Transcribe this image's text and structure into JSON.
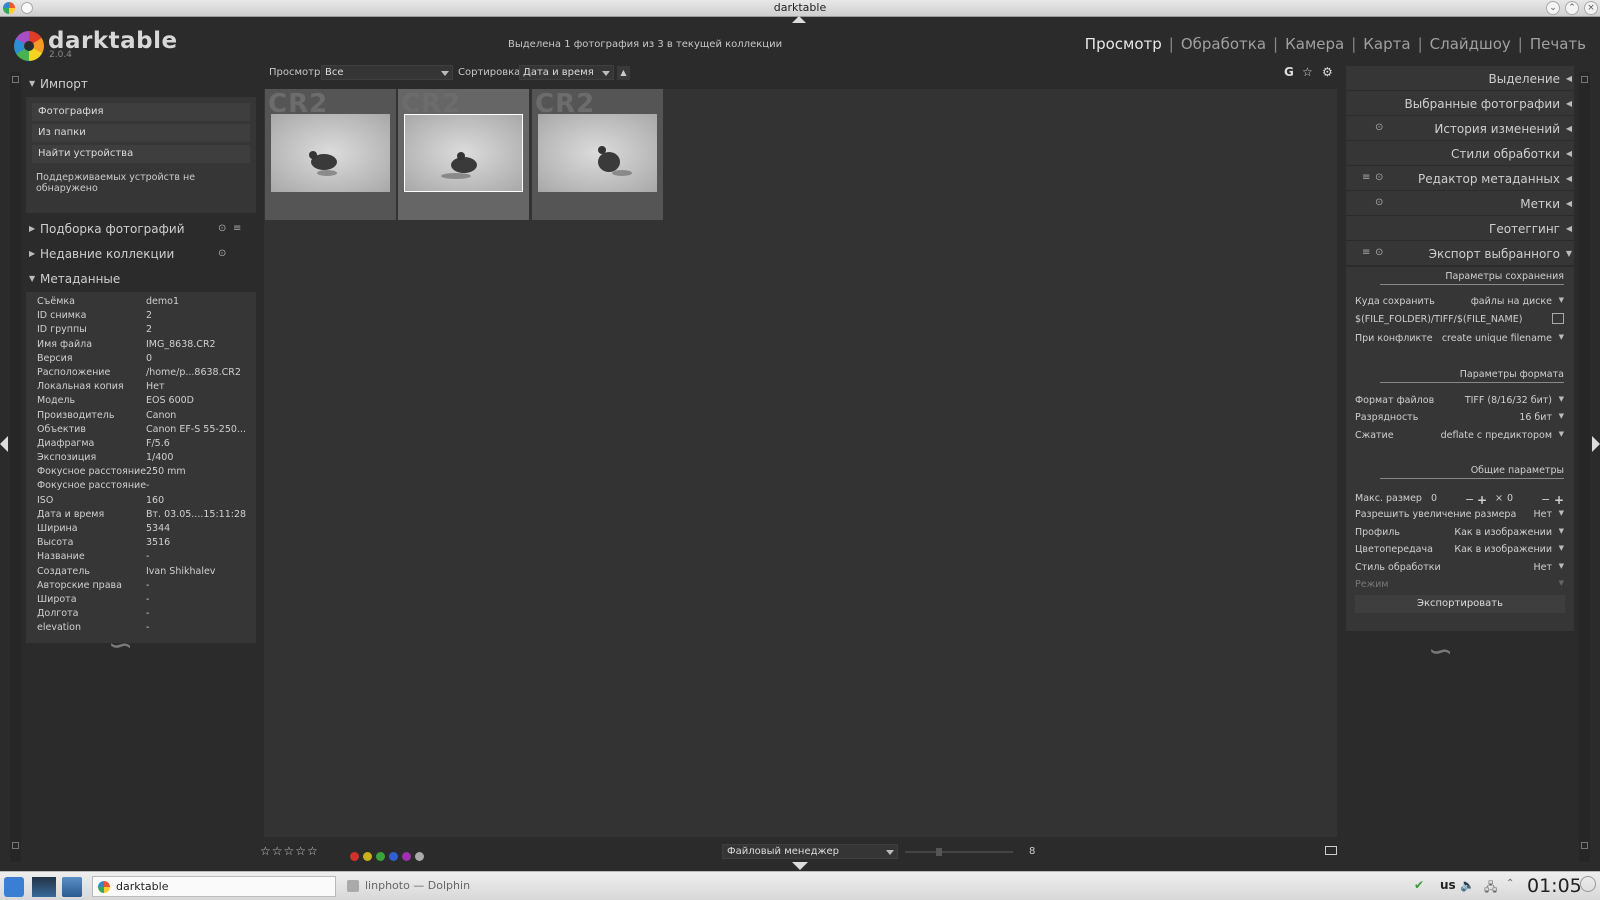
{
  "window": {
    "title": "darktable"
  },
  "app": {
    "name": "darktable",
    "version": "2.0.4"
  },
  "status": "Выделена 1 фотография из 3 в текущей коллекции",
  "views": [
    {
      "label": "Просмотр",
      "active": true
    },
    {
      "label": "Обработка",
      "active": false
    },
    {
      "label": "Камера",
      "active": false
    },
    {
      "label": "Карта",
      "active": false
    },
    {
      "label": "Слайдшоу",
      "active": false
    },
    {
      "label": "Печать",
      "active": false
    }
  ],
  "view_separator": "|",
  "toolbar": {
    "view_label": "Просмотр",
    "view_value": "Все",
    "sort_label": "Сортировка",
    "sort_value": "Дата и время",
    "sort_dir": "▲",
    "grouping_icon": "G",
    "star_icon": "☆",
    "gear_icon": "⚙"
  },
  "left": {
    "import": {
      "title": "Импорт",
      "buttons": [
        "Фотография",
        "Из папки",
        "Найти устройства"
      ],
      "message": "Поддерживаемых устройств не обнаружено"
    },
    "collect": {
      "title": "Подборка фотографий"
    },
    "recent": {
      "title": "Недавние коллекции"
    },
    "metadata": {
      "title": "Метаданные",
      "rows": [
        [
          "Съёмка",
          "demo1"
        ],
        [
          "ID снимка",
          "2"
        ],
        [
          "ID группы",
          "2"
        ],
        [
          "Имя файла",
          "IMG_8638.CR2"
        ],
        [
          "Версия",
          "0"
        ],
        [
          "Расположение",
          "/home/p...8638.CR2"
        ],
        [
          "Локальная копия",
          "Нет"
        ],
        [
          "Модель",
          "EOS 600D"
        ],
        [
          "Производитель",
          "Canon"
        ],
        [
          "Объектив",
          "Canon EF-S 55-250..."
        ],
        [
          "Диафрагма",
          "F/5.6"
        ],
        [
          "Экспозиция",
          "1/400"
        ],
        [
          "Фокусное расстояние",
          "250 mm"
        ],
        [
          "Фокусное расстояние",
          "-"
        ],
        [
          "ISO",
          "160"
        ],
        [
          "Дата и время",
          "Вт. 03.05....15:11:28"
        ],
        [
          "Ширина",
          "5344"
        ],
        [
          "Высота",
          "3516"
        ],
        [
          "Название",
          "-"
        ],
        [
          "Создатель",
          "Ivan Shikhalev"
        ],
        [
          "Авторские права",
          "-"
        ],
        [
          "Широта",
          "-"
        ],
        [
          "Долгота",
          "-"
        ],
        [
          "elevation",
          "-"
        ]
      ]
    }
  },
  "thumbnails": [
    {
      "ext": "CR2",
      "selected": false
    },
    {
      "ext": "CR2",
      "selected": true
    },
    {
      "ext": "CR2",
      "selected": false
    }
  ],
  "bottom": {
    "stars": "☆☆☆☆☆",
    "color_labels": [
      "#d0312d",
      "#c8b11a",
      "#3aa53a",
      "#2f5fd0",
      "#a030b0",
      "#aaaaaa"
    ],
    "layout": "Файловый менеджер",
    "zoom": "8",
    "zoom_fraction": 0.3
  },
  "right": {
    "sections": [
      {
        "title": "Выделение",
        "icons": ""
      },
      {
        "title": "Выбранные фотографии",
        "icons": ""
      },
      {
        "title": "История изменений",
        "icons": "⊙"
      },
      {
        "title": "Стили обработки",
        "icons": ""
      },
      {
        "title": "Редактор метаданных",
        "icons": "≡ ⊙"
      },
      {
        "title": "Метки",
        "icons": "⊙"
      },
      {
        "title": "Геотеггинг",
        "icons": ""
      },
      {
        "title": "Экспорт выбранного",
        "icons": "≡ ⊙"
      }
    ],
    "export": {
      "storage_head": "Параметры сохранения",
      "target_label": "Куда сохранить",
      "target_value": "файлы на диске",
      "path": "$(FILE_FOLDER)/TIFF/$(FILE_NAME)",
      "conflict_label": "При конфликте",
      "conflict_value": "create unique filename",
      "format_head": "Параметры формата",
      "format_label": "Формат файлов",
      "format_value": "TIFF (8/16/32 бит)",
      "bpp_label": "Разрядность",
      "bpp_value": "16 бит",
      "compress_label": "Сжатие",
      "compress_value": "deflate с предиктором",
      "global_head": "Общие параметры",
      "maxsize_label": "Макс. размер",
      "maxsize_w": "0",
      "maxsize_h": "0",
      "times": "×",
      "upscale_label": "Разрешить увеличение размера",
      "upscale_value": "Нет",
      "profile_label": "Профиль",
      "profile_value": "Как в изображении",
      "intent_label": "Цветопередача",
      "intent_value": "Как в изображении",
      "style_label": "Стиль обработки",
      "style_value": "Нет",
      "mode_label": "Режим",
      "export_button": "Экспортировать"
    }
  },
  "taskbar": {
    "tasks": [
      {
        "label": "darktable",
        "active": true
      },
      {
        "label": "linphoto — Dolphin",
        "active": false
      }
    ],
    "keyboard": "us",
    "clock": "01:05"
  }
}
